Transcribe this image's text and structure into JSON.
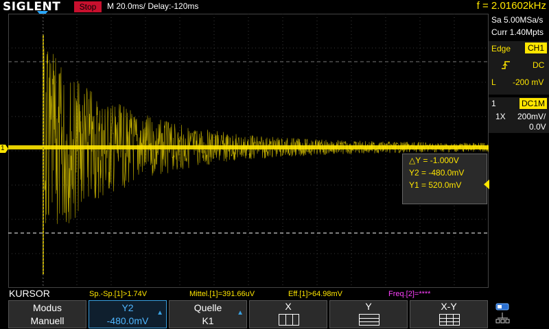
{
  "header": {
    "brand": "SIGLENT",
    "run_state": "Stop",
    "timebase": "M 20.0ms/ Delay:-120ms",
    "frequency": "f = 2.01602kHz"
  },
  "acquisition": {
    "sample_rate": "Sa 5.00MSa/s",
    "memory_depth": "Curr 1.40Mpts"
  },
  "trigger": {
    "type": "Edge",
    "source": "CH1",
    "slope_icon": "rising-edge-icon",
    "coupling": "DC",
    "level_label": "L",
    "level": "-200 mV"
  },
  "channel": {
    "number": "1",
    "coupling": "DC1M",
    "probe": "1X",
    "vdiv": "200mV/",
    "offset": "0.0V",
    "marker": "1"
  },
  "cursor_readout": {
    "delta_y": "△Y = -1.000V",
    "y2": "Y2 = -480.0mV",
    "y1": "Y1 = 520.0mV"
  },
  "status_bar": {
    "mode": "KURSOR",
    "measurements": [
      {
        "text": "Sp.-Sp.[1]>1.74V",
        "color": "#ffe600"
      },
      {
        "text": "Mittel.[1]=391.66uV",
        "color": "#ffe600"
      },
      {
        "text": "Eff.[1]>64.98mV",
        "color": "#ffe600"
      },
      {
        "text": "Freq.[2]=****",
        "color": "#ff40ff"
      }
    ]
  },
  "softmenu": {
    "modus_l1": "Modus",
    "modus_l2": "Manuell",
    "y2_l1": "Y2",
    "y2_l2": "-480.0mV",
    "quelle_l1": "Quelle",
    "quelle_l2": "K1",
    "x_label": "X",
    "y_label": "Y",
    "xy_label": "X-Y",
    "settings_icon": "network-icon"
  },
  "colors": {
    "trace": "#ffe600",
    "accent": "#3aa0e0",
    "stop": "#c8102e"
  }
}
